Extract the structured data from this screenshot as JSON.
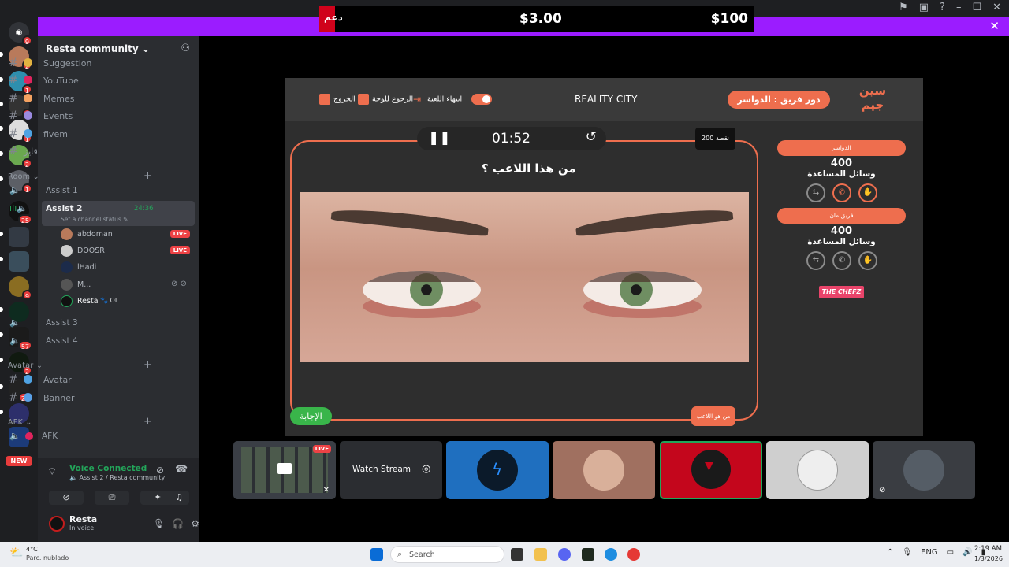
{
  "sponsor": {
    "label": "دعم",
    "price1": "$3.00",
    "price2": "$100"
  },
  "server_badges": [
    "9",
    "2",
    "1",
    "1",
    "1",
    "2",
    "1",
    "25",
    "9",
    "57",
    "2",
    "25"
  ],
  "new_label": "NEW",
  "sidebar": {
    "server_name": "Resta community",
    "channels_top": [
      {
        "name": "Suggestion",
        "color": "#e3b341"
      },
      {
        "name": "YouTube",
        "color": "#e0245e"
      },
      {
        "name": "Memes",
        "color": "#f4a261"
      },
      {
        "name": "Events",
        "color": "#9b8ae0"
      },
      {
        "name": "fivem",
        "color": "#4fa3e3"
      },
      {
        "name": "قايز",
        "color": ""
      }
    ],
    "room_category": "Room",
    "voice_channels": [
      "Assist 1",
      "Assist 2",
      "Assist 3",
      "Assist 4"
    ],
    "active_time": "24:36",
    "channel_status": "Set a channel status",
    "users": [
      {
        "name": "abdoman",
        "live": true
      },
      {
        "name": "DOOSR",
        "live": true
      },
      {
        "name": "lHadi",
        "live": false
      },
      {
        "name": "M...",
        "live": false
      },
      {
        "name": "Resta",
        "live": false,
        "tag": "OL"
      }
    ],
    "live_label": "LIVE",
    "avatar_category": "Avatar",
    "avatar_channels": [
      "Avatar",
      "Banner"
    ],
    "afk_category": "AFK",
    "afk_channel": "AFK"
  },
  "voice": {
    "status": "Voice Connected",
    "channel": "Assist 2 / Resta community",
    "user": "Resta",
    "user_status": "In voice"
  },
  "game": {
    "title": "REALITY CITY",
    "team_turn": "دور فريق : الدواسر",
    "logo": "سين جيم",
    "end_game": "انتهاء اللعبة",
    "back_board": "الرجوع للوحة",
    "exit": "الخروج",
    "timer": "01:52",
    "points": "200 نقطة",
    "question": "من هذا اللاعب ؟",
    "answer_button": "الإجابة",
    "who_button": "من هو اللاعب",
    "teams": [
      {
        "name": "الدواسر",
        "score": "400",
        "helpers": "وسائل المساعدة"
      },
      {
        "name": "فريق مان",
        "score": "400",
        "helpers": "وسائل المساعدة"
      }
    ],
    "sponsor_logo": "THE CHEFZ"
  },
  "tiles": {
    "watch": "Watch Stream",
    "live": "LIVE"
  },
  "taskbar": {
    "temp": "4°C",
    "condition": "Parc. nublado",
    "search": "Search",
    "lang": "ENG",
    "time": "2:19 AM",
    "date": "1/3/2026"
  }
}
